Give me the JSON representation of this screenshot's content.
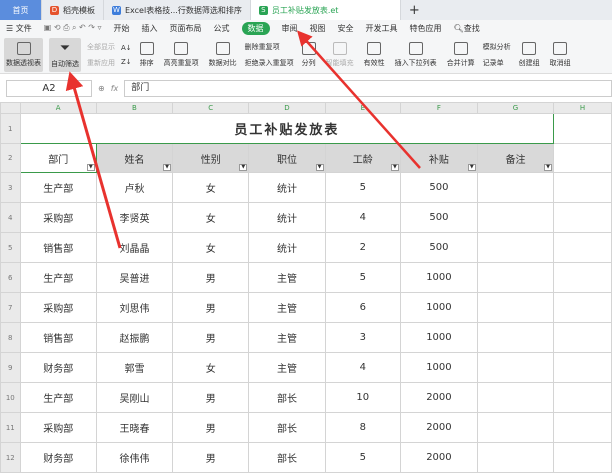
{
  "tabs": [
    {
      "label": "首页"
    },
    {
      "label": "稻壳模板"
    },
    {
      "label": "Excel表格技...行数据筛选和排序"
    },
    {
      "label": "员工补贴发放表.et"
    }
  ],
  "menu": [
    "文件",
    "开始",
    "插入",
    "页面布局",
    "公式",
    "数据",
    "审阅",
    "视图",
    "安全",
    "开发工具",
    "特色应用",
    "查找"
  ],
  "ribbon": {
    "pivot": "数据透视表",
    "autofilter": "自动筛选",
    "show_all": "全部显示",
    "reapply": "重新应用",
    "sort": "排序",
    "highlight_dup": "高亮重复项",
    "compare": "数据对比",
    "remove_dup": "删除重复项",
    "reject_dup": "拒绝录入重复项",
    "split": "分列",
    "smart_fill": "智能填充",
    "validity": "有效性",
    "insert_dropdown": "插入下拉列表",
    "consolidate": "合并计算",
    "simulate": "模拟分析",
    "record": "记录单",
    "group": "创建组",
    "ungroup": "取消组"
  },
  "formula": {
    "cell": "A2",
    "fx": "fx",
    "value": "部门"
  },
  "columns": [
    "A",
    "B",
    "C",
    "D",
    "E",
    "F",
    "G",
    "H"
  ],
  "sheet": {
    "title": "员工补贴发放表",
    "headers": [
      "部门",
      "姓名",
      "性别",
      "职位",
      "工龄",
      "补贴",
      "备注"
    ],
    "rows": [
      [
        "生产部",
        "卢秋",
        "女",
        "统计",
        "5",
        "500",
        ""
      ],
      [
        "采购部",
        "李贤英",
        "女",
        "统计",
        "4",
        "500",
        ""
      ],
      [
        "销售部",
        "刘晶晶",
        "女",
        "统计",
        "2",
        "500",
        ""
      ],
      [
        "生产部",
        "吴普进",
        "男",
        "主管",
        "5",
        "1000",
        ""
      ],
      [
        "采购部",
        "刘思伟",
        "男",
        "主管",
        "6",
        "1000",
        ""
      ],
      [
        "销售部",
        "赵振鹏",
        "男",
        "主管",
        "3",
        "1000",
        ""
      ],
      [
        "财务部",
        "郭雪",
        "女",
        "主管",
        "4",
        "1000",
        ""
      ],
      [
        "生产部",
        "吴刚山",
        "男",
        "部长",
        "10",
        "2000",
        ""
      ],
      [
        "采购部",
        "王晓春",
        "男",
        "部长",
        "8",
        "2000",
        ""
      ],
      [
        "财务部",
        "徐伟伟",
        "男",
        "部长",
        "5",
        "2000",
        ""
      ]
    ]
  },
  "colors": {
    "accent": "#2aa454",
    "arrow": "#e8322e"
  }
}
